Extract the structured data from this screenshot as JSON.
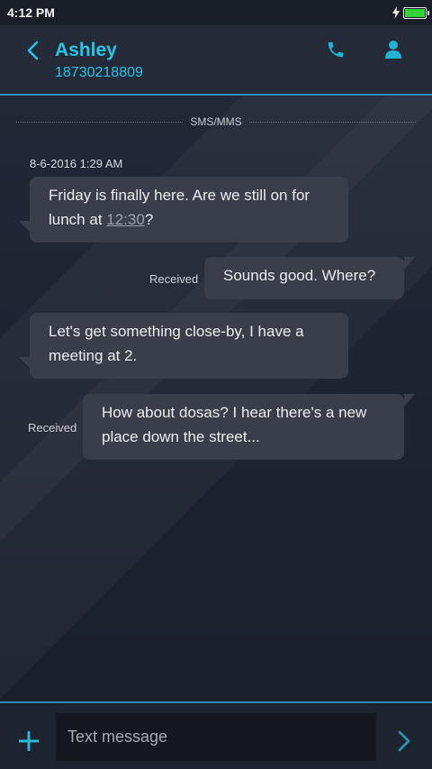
{
  "status_bar": {
    "time": "4:12 PM"
  },
  "header": {
    "contact_name": "Ashley",
    "contact_number": "18730218809",
    "accent_color": "#24c6e6"
  },
  "thread": {
    "channel_label": "SMS/MMS",
    "timestamp": "8-6-2016 1:29 AM",
    "messages": [
      {
        "direction": "incoming",
        "text_before": "Friday is finally here. Are we still on for lunch at ",
        "link": "12:30",
        "text_after": "?"
      },
      {
        "direction": "outgoing",
        "status": "Received",
        "text": "Sounds good. Where?"
      },
      {
        "direction": "incoming",
        "text": "Let's get something close-by, I have a meeting at 2."
      },
      {
        "direction": "outgoing",
        "status": "Received",
        "text": "How about dosas? I hear there's a new place down the street..."
      }
    ]
  },
  "composer": {
    "placeholder": "Text message"
  },
  "icons": {
    "back": "chevron-left-icon",
    "call": "phone-icon",
    "profile": "person-icon",
    "add": "plus-icon",
    "send": "chevron-right-icon"
  }
}
